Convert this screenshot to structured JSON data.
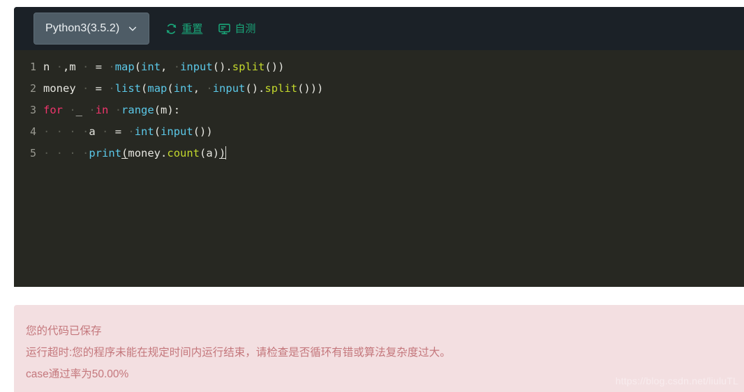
{
  "toolbar": {
    "language": {
      "label": "Python3(3.5.2)",
      "icon": "chevron-down-icon"
    },
    "buttons": [
      {
        "label": "重置",
        "icon": "refresh-icon",
        "underlined": true
      },
      {
        "label": "自测",
        "icon": "monitor-icon",
        "underlined": false
      }
    ],
    "accent_color": "#1aa87a",
    "background_color": "#1b2127",
    "select_background": "#4e5c66"
  },
  "editor": {
    "background_color": "#272822",
    "line_number_color": "#9a9a92",
    "token_colors": {
      "plain": "#e6e6e0",
      "builtin": "#5bc8e8",
      "keyword": "#f0356c",
      "method": "#c3d82c",
      "whitespace": "#5a5c52"
    },
    "lines": [
      {
        "number": "1",
        "text": "n ·,m · = ·map(int, ·input().split())"
      },
      {
        "number": "2",
        "text": "money · = ·list(map(int, ·input().split()))"
      },
      {
        "number": "3",
        "text": "for ·_ ·in ·range(m):"
      },
      {
        "number": "4",
        "text": "····a · = ·int(input())"
      },
      {
        "number": "5",
        "text": "····print(money.count(a))"
      }
    ]
  },
  "result": {
    "background_color": "#f3dfe1",
    "text_color": "#c4777c",
    "lines": [
      "您的代码已保存",
      "运行超时:您的程序未能在规定时间内运行结束，请检查是否循环有错或算法复杂度过大。",
      "case通过率为50.00%"
    ],
    "watermark": "https://blog.csdn.net/liuluTL"
  }
}
